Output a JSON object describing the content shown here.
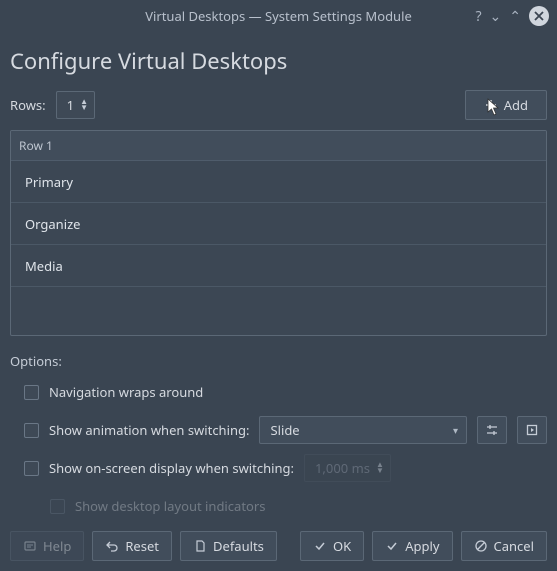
{
  "window": {
    "title": "Virtual Desktops — System Settings Module"
  },
  "header": {
    "page_title": "Configure Virtual Desktops",
    "rows_label": "Rows:",
    "rows_value": "1",
    "add_button": "Add"
  },
  "desktops": {
    "row_header": "Row 1",
    "items": [
      {
        "name": "Primary"
      },
      {
        "name": "Organize"
      },
      {
        "name": "Media"
      }
    ]
  },
  "options": {
    "section_label": "Options:",
    "nav_wraps": "Navigation wraps around",
    "show_anim": "Show animation when switching:",
    "anim_value": "Slide",
    "show_osd": "Show on-screen display when switching:",
    "osd_duration": "1,000 ms",
    "show_layout_ind": "Show desktop layout indicators"
  },
  "buttons": {
    "help": "Help",
    "reset": "Reset",
    "defaults": "Defaults",
    "ok": "OK",
    "apply": "Apply",
    "cancel": "Cancel"
  }
}
